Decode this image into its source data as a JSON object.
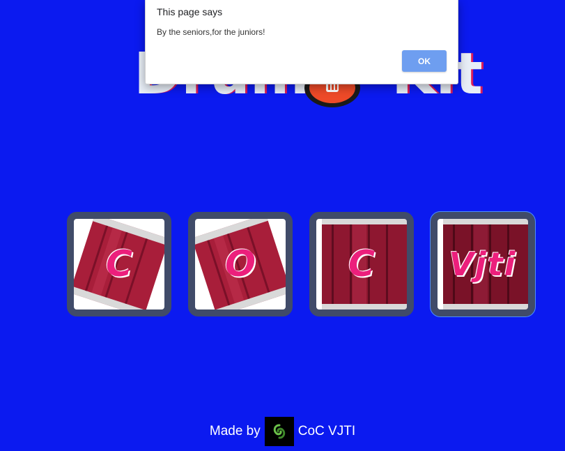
{
  "page": {
    "background_color": "#0b1af0"
  },
  "title": {
    "left_word": "Drum",
    "right_word": "Kit",
    "icon": "drum-icon"
  },
  "drums": [
    {
      "letter": "C",
      "icon": "drum-icon"
    },
    {
      "letter": "O",
      "icon": "drum-icon"
    },
    {
      "letter": "C",
      "icon": "drum-icon"
    },
    {
      "letter": "Vjti",
      "icon": "drum-icon"
    }
  ],
  "footer": {
    "made_by": "Made by",
    "org": "CoC VJTI",
    "logo_icon": "coc-logo-icon"
  },
  "dialog": {
    "title": "This page says",
    "message": "By the seniors,for the juniors!",
    "ok_label": "OK",
    "button_color": "#6e9ef0"
  }
}
